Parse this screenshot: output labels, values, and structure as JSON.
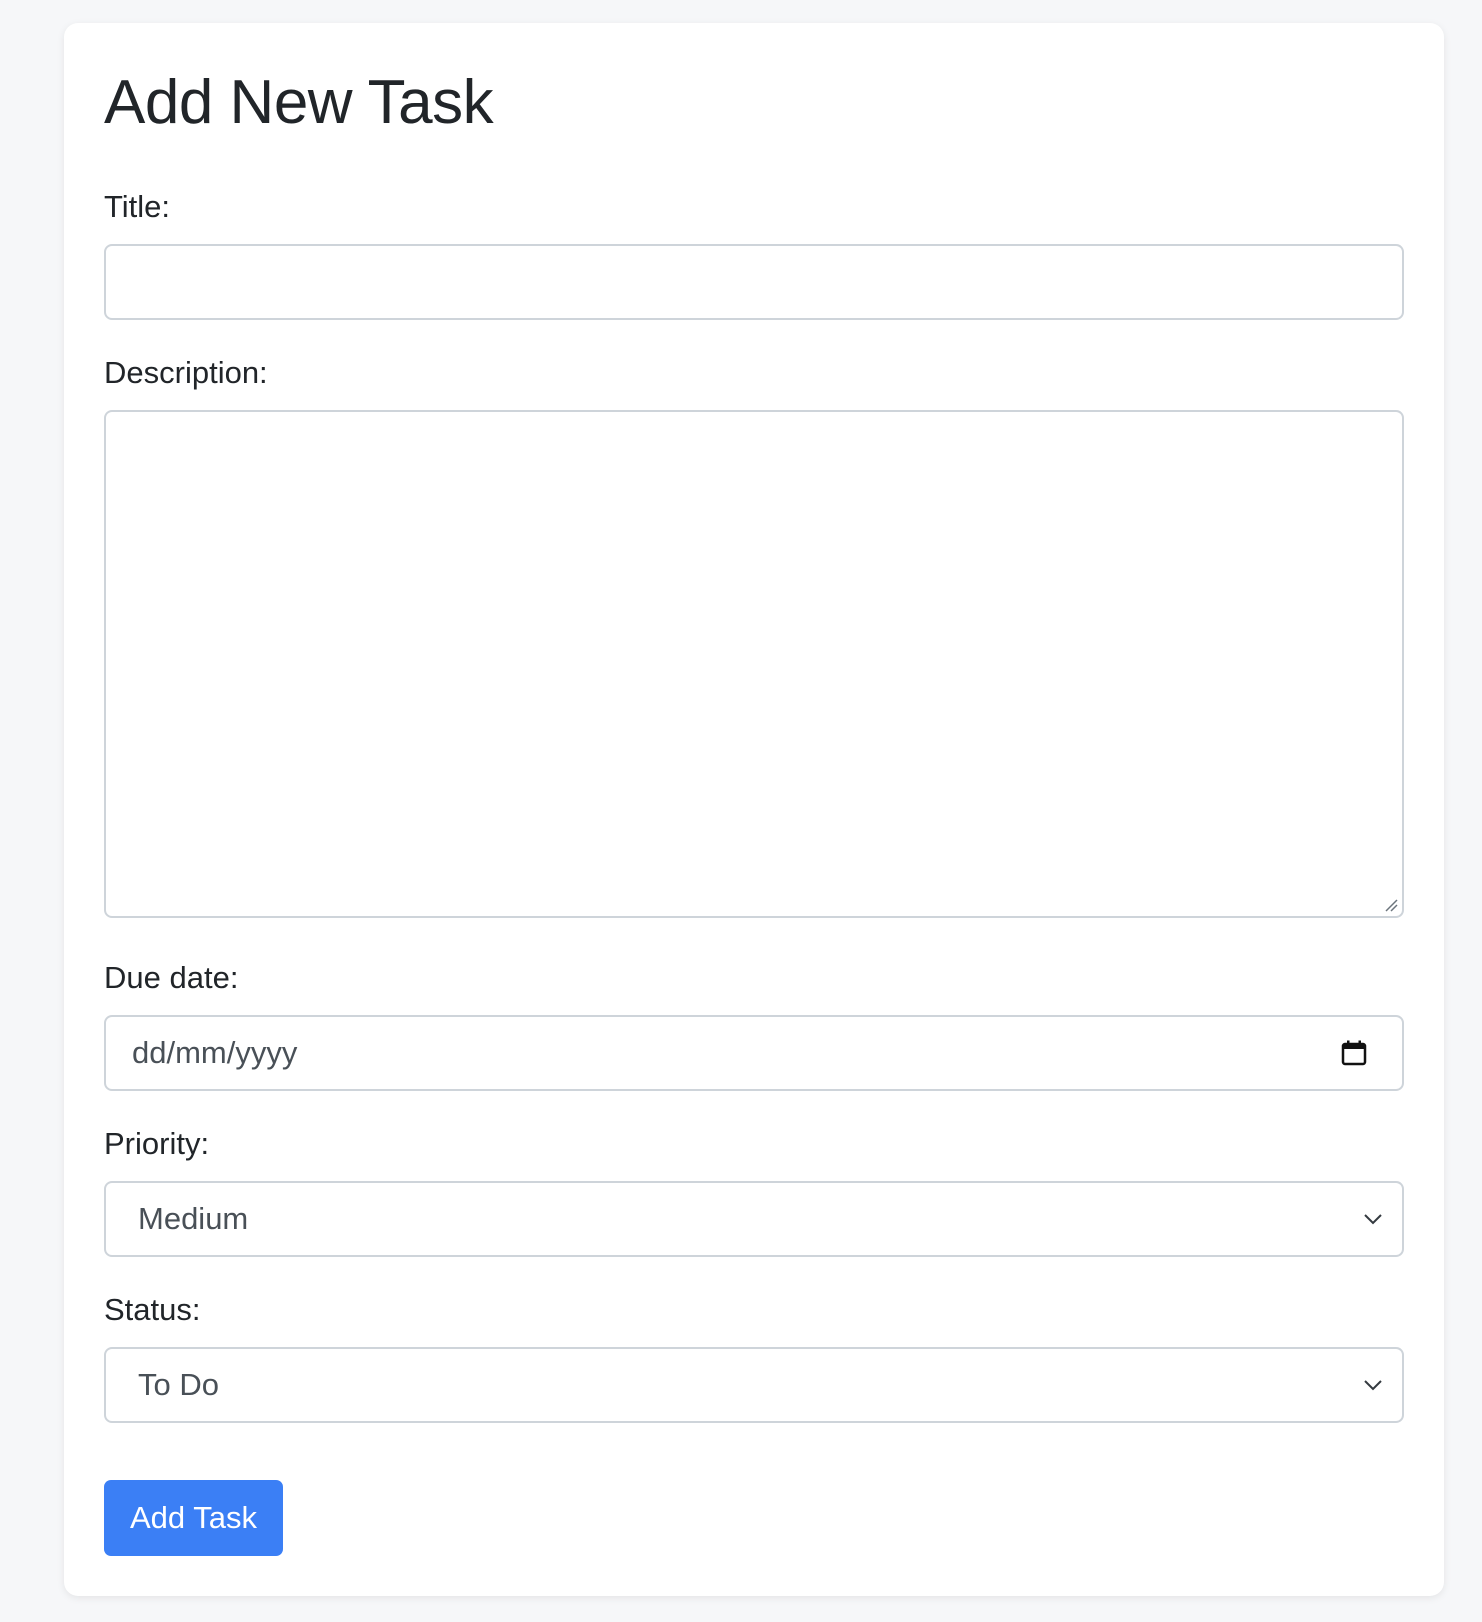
{
  "form": {
    "heading": "Add New Task",
    "title_label": "Title:",
    "title_value": "",
    "description_label": "Description:",
    "description_value": "",
    "due_date_label": "Due date:",
    "due_date_placeholder": "dd/mm/yyyy",
    "priority_label": "Priority:",
    "priority_selected": "Medium",
    "status_label": "Status:",
    "status_selected": "To Do",
    "submit_label": "Add Task"
  },
  "icons": {
    "calendar": "calendar-icon",
    "chevron": "chevron-down-icon",
    "resize": "resize-grip-icon"
  },
  "colors": {
    "page_bg": "#f6f7f9",
    "card_bg": "#ffffff",
    "border": "#ced4da",
    "primary": "#3b7ff5",
    "text": "#212529"
  }
}
